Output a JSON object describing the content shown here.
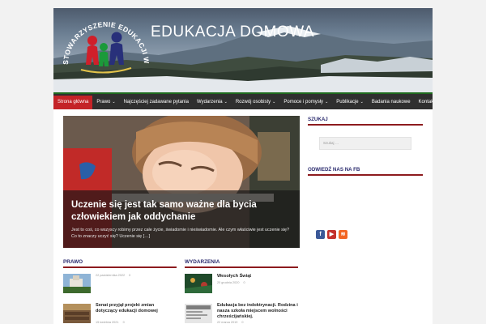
{
  "site": {
    "title": "EDUKACJA DOMOWA",
    "logo_text": "STOWARZYSZENIE EDUKACJI W RODZINIE"
  },
  "nav": {
    "items": [
      {
        "label": "Strona główna",
        "active": true,
        "has_dropdown": false
      },
      {
        "label": "Prawo",
        "active": false,
        "has_dropdown": true
      },
      {
        "label": "Najczęściej zadawane pytania",
        "active": false,
        "has_dropdown": false
      },
      {
        "label": "Wydarzenia",
        "active": false,
        "has_dropdown": true
      },
      {
        "label": "Rozwój osobisty",
        "active": false,
        "has_dropdown": true
      },
      {
        "label": "Pomoce i pomysły",
        "active": false,
        "has_dropdown": true
      },
      {
        "label": "Publikacje",
        "active": false,
        "has_dropdown": true
      },
      {
        "label": "Badania naukowe",
        "active": false,
        "has_dropdown": false
      },
      {
        "label": "Kontakt",
        "active": false,
        "has_dropdown": false
      }
    ],
    "chevron": "⌄"
  },
  "hero": {
    "title": "Uczenie się jest tak samo ważne dla bycia człowiekiem jak oddychanie",
    "excerpt": "Jest to coś, co wszyscy robimy przez całe życie, świadomie i nieświadomie. Ale czym właściwie jest uczenie się? Co to znaczy uczyć się? Uczenie się […]"
  },
  "sidebar": {
    "search_title": "SZUKAJ",
    "search_placeholder": "Szukaj …",
    "fb_title": "ODWIEDŹ NAS NA FB",
    "social": [
      {
        "icon": "facebook-icon",
        "glyph": "f",
        "color": "#3b5998"
      },
      {
        "icon": "youtube-icon",
        "glyph": "▶",
        "color": "#c4302b"
      },
      {
        "icon": "rss-icon",
        "glyph": "≋",
        "color": "#f26522"
      }
    ]
  },
  "sections": {
    "prawo": {
      "title": "PRAWO",
      "posts": [
        {
          "title": "",
          "date": "22 października 2022",
          "comments": "0"
        },
        {
          "title": "Senat przyjął projekt zmian dotyczący edukacji domowej",
          "date": "15 kwietnia 2021",
          "comments": "0"
        }
      ]
    },
    "wydarzenia": {
      "title": "WYDARZENIA",
      "posts": [
        {
          "title": "Wesołych Świąt",
          "date": "20 grudnia 2020",
          "comments": "0"
        },
        {
          "title": "Edukacja bez indoktrynacji. Rodzina i nasza szkoła miejscem wolności chrześcijańskiej.",
          "date": "22 marca 2019",
          "comments": "0"
        }
      ]
    }
  },
  "colors": {
    "accent_red": "#c42327",
    "nav_bg": "#2f2f2f",
    "nav_border": "#1f6b1f",
    "heading_blue": "#2b2b6e",
    "underline": "#8d1b1e"
  }
}
